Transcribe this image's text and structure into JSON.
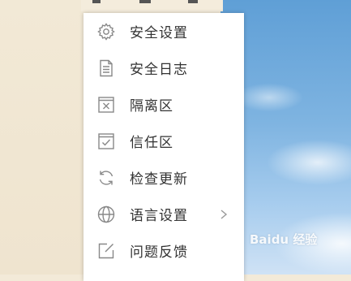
{
  "menu": {
    "items": [
      {
        "label": "安全设置",
        "icon": "gear-icon"
      },
      {
        "label": "安全日志",
        "icon": "document-icon"
      },
      {
        "label": "隔离区",
        "icon": "quarantine-box-icon"
      },
      {
        "label": "信任区",
        "icon": "checkbox-icon"
      },
      {
        "label": "检查更新",
        "icon": "refresh-icon"
      },
      {
        "label": "语言设置",
        "icon": "globe-icon",
        "submenu": true
      },
      {
        "label": "问题反馈",
        "icon": "edit-icon"
      }
    ]
  },
  "watermark": {
    "text": "Baidu 经验"
  },
  "colors": {
    "menu_bg": "#ffffff",
    "text": "#333333",
    "icon": "#888888",
    "left_bg": "#f2e9d6",
    "sky": "#7fb4e1"
  }
}
